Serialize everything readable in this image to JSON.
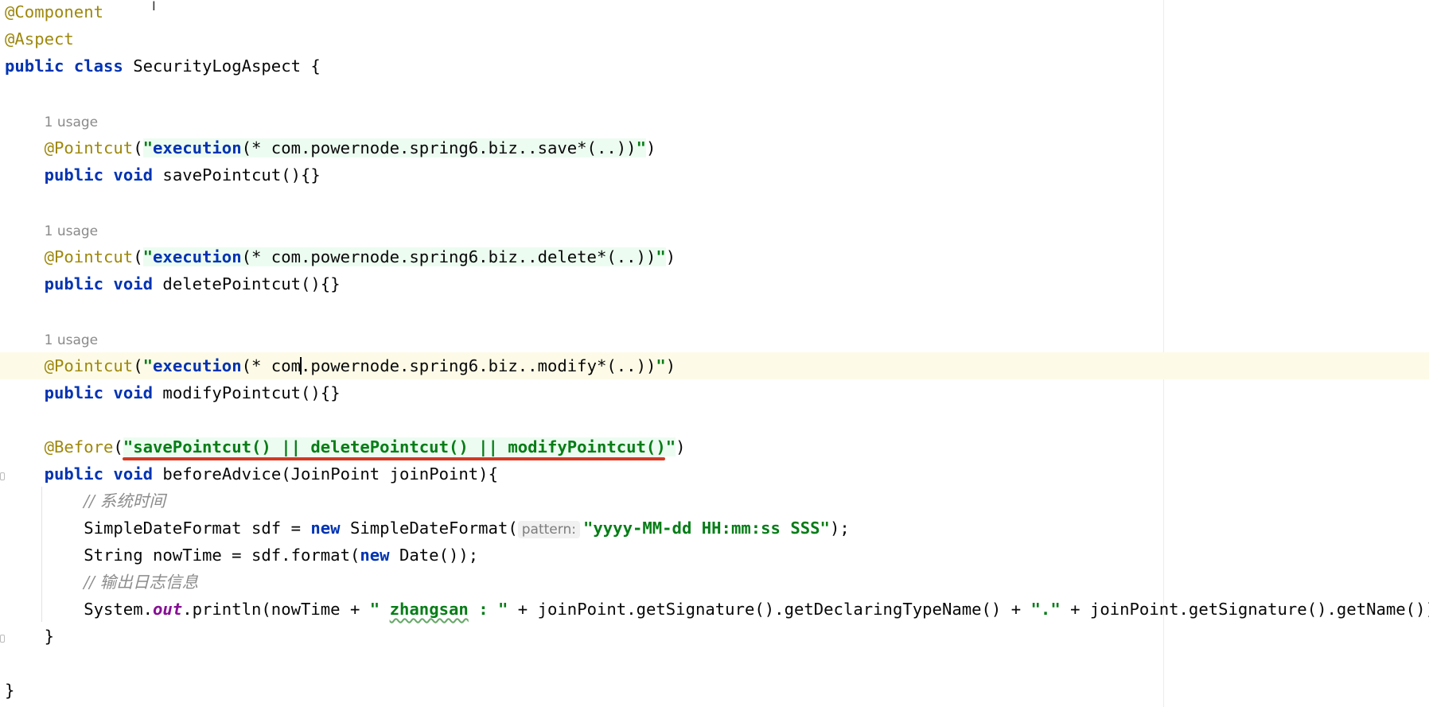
{
  "usage_hint": "1 usage",
  "code": {
    "l1_ann": "@Component",
    "l2_ann": "@Aspect",
    "l3_kw1": "public",
    "l3_kw2": "class",
    "l3_rest": " SecurityLogAspect {",
    "pc_ann": "@Pointcut",
    "pc_open": "(",
    "quote": "\"",
    "exec_kw": "execution",
    "save_expr": "(* com.powernode.spring6.biz..save*(..))",
    "delete_expr": "(* com.powernode.spring6.biz..delete*(..))",
    "modify_expr_a": "(* com",
    "modify_expr_b": ".powernode.spring6.biz..modify*(..))",
    "close_paren": ")",
    "kw_public": "public",
    "kw_void": "void",
    "save_method": " savePointcut(){}",
    "delete_method": " deletePointcut(){}",
    "modify_method": " modifyPointcut(){}",
    "before_ann": "@Before",
    "before_expr": "\"savePointcut() || deletePointcut() || modifyPointcut()\"",
    "before_method": " beforeAdvice(JoinPoint joinPoint){",
    "comment1": "// 系统时间",
    "sdf_a": "SimpleDateFormat sdf = ",
    "kw_new": "new",
    "sdf_b": " SimpleDateFormat(",
    "sdf_hint": "pattern:",
    "sdf_str": "\"yyyy-MM-dd HH:mm:ss SSS\"",
    "sdf_c": ");",
    "now_a": "String nowTime = sdf.format(",
    "now_b": " Date());",
    "comment2": "// 输出日志信息",
    "sys_a": "System.",
    "sys_out": "out",
    "sys_b": ".println(nowTime + ",
    "sys_str_q1": "\" ",
    "sys_str_name": "zhangsan",
    "sys_str_rest": " : \"",
    "sys_c": " + joinPoint.getSignature().getDeclaringTypeName() + ",
    "sys_dot": "\".\"",
    "sys_d": " + joinPoint.getSignature().getName());",
    "close_method": "}",
    "close_class": "}"
  },
  "colors": {
    "keyword": "#0033b3",
    "annotation": "#9e880d",
    "string": "#067d17",
    "comment": "#8c8c8c",
    "current_line": "#fdfbe7",
    "red_underline": "#d13a24"
  },
  "icons": {
    "mouse_cursor": "text-cursor-icon"
  }
}
